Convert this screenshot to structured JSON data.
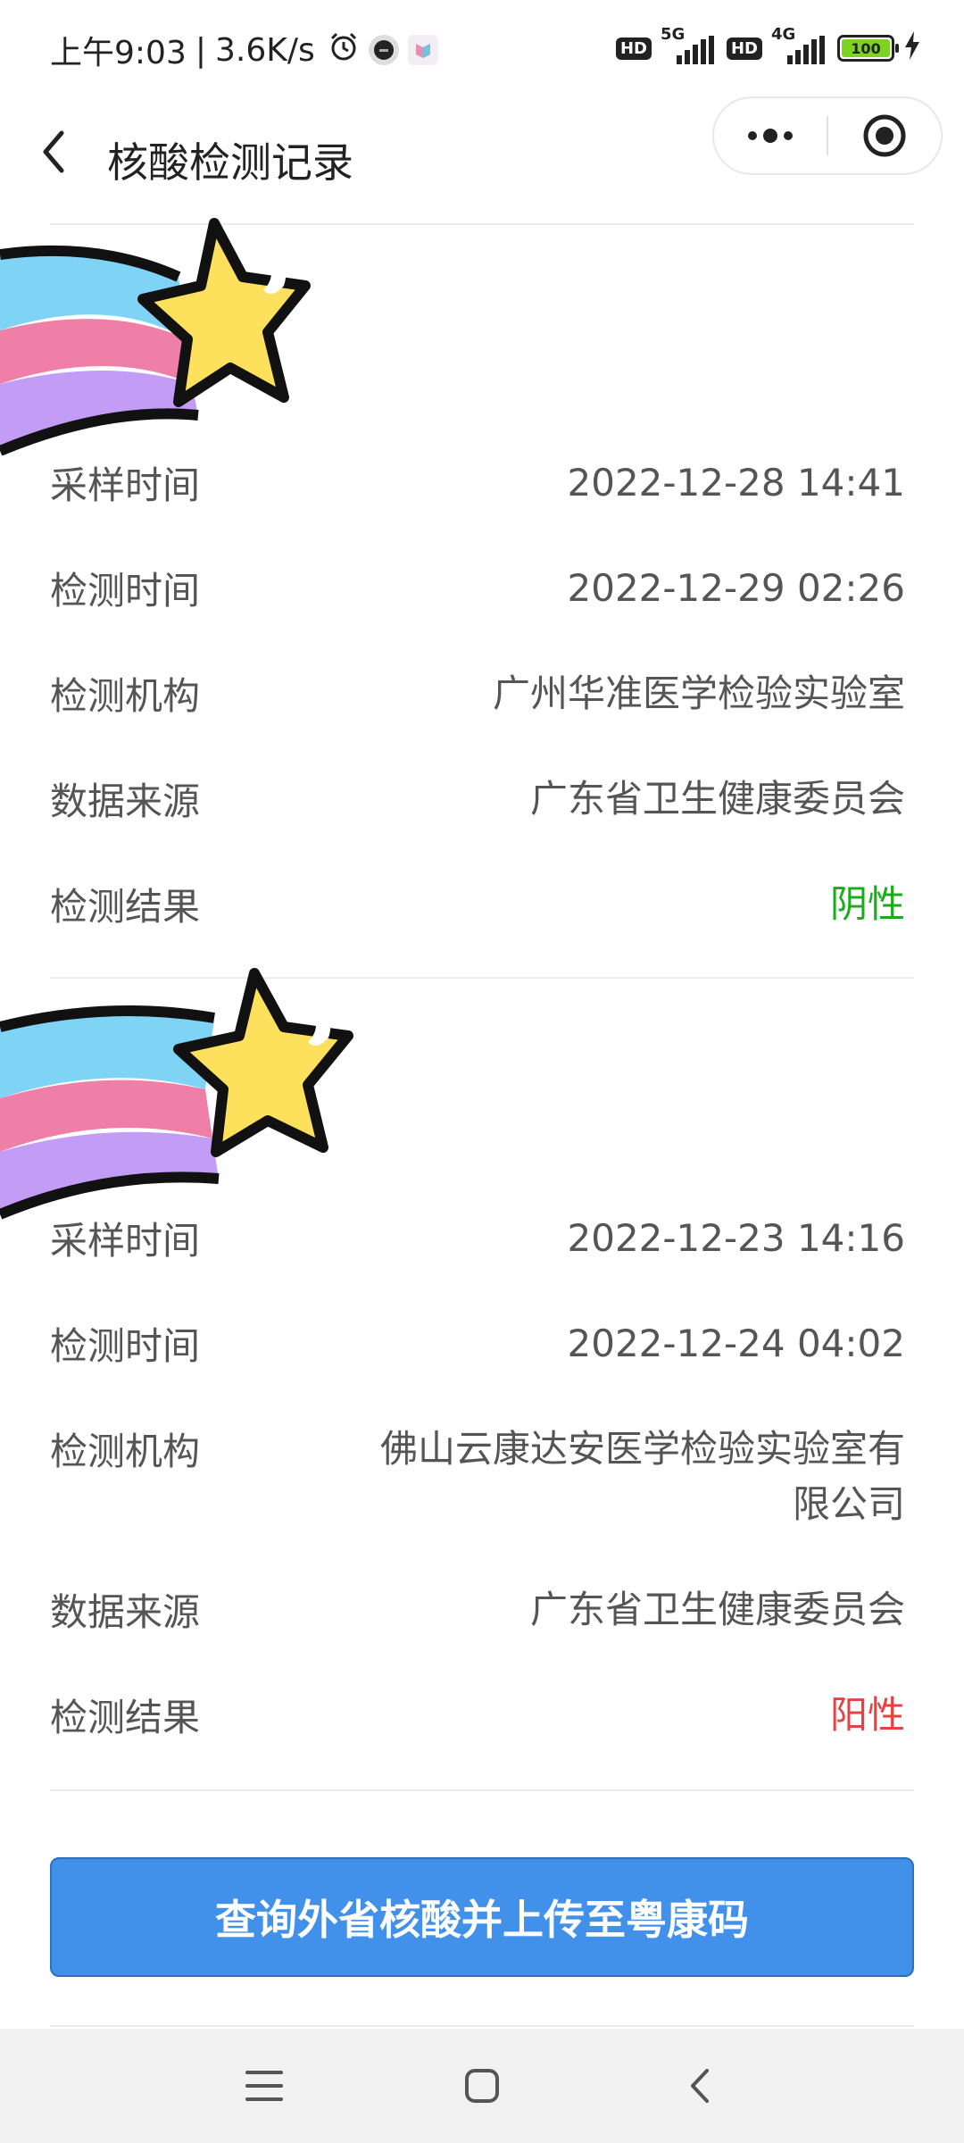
{
  "status_bar": {
    "time": "上午9:03",
    "separator": "|",
    "speed": "3.6K/s",
    "hd_badge": "HD",
    "net1": "5G",
    "net2": "4G",
    "battery": "100"
  },
  "header": {
    "title": "核酸检测记录"
  },
  "records": [
    {
      "rows": [
        {
          "label": "采样时间",
          "value": "2022-12-28 14:41"
        },
        {
          "label": "检测时间",
          "value": "2022-12-29 02:26"
        },
        {
          "label": "检测机构",
          "value": "广州华准医学检验实验室"
        },
        {
          "label": "数据来源",
          "value": "广东省卫生健康委员会"
        },
        {
          "label": "检测结果",
          "value": "阴性"
        }
      ]
    },
    {
      "rows": [
        {
          "label": "采样时间",
          "value": "2022-12-23 14:16"
        },
        {
          "label": "检测时间",
          "value": "2022-12-24 04:02"
        },
        {
          "label": "检测机构",
          "value_line1": "佛山云康达安医学检验实验室有",
          "value_line2": "限公司"
        },
        {
          "label": "数据来源",
          "value": "广东省卫生健康委员会"
        },
        {
          "label": "检测结果",
          "value": "阳性"
        }
      ]
    }
  ],
  "cta": {
    "label": "查询外省核酸并上传至粤康码"
  },
  "colors": {
    "negative": "#1aad19",
    "positive": "#e94141",
    "button": "#4190ea"
  },
  "icons": [
    "back-arrow-icon",
    "more-dots-icon",
    "close-target-icon",
    "alarm-icon",
    "star-sticker",
    "menu-icon",
    "home-icon",
    "back-nav-icon"
  ]
}
